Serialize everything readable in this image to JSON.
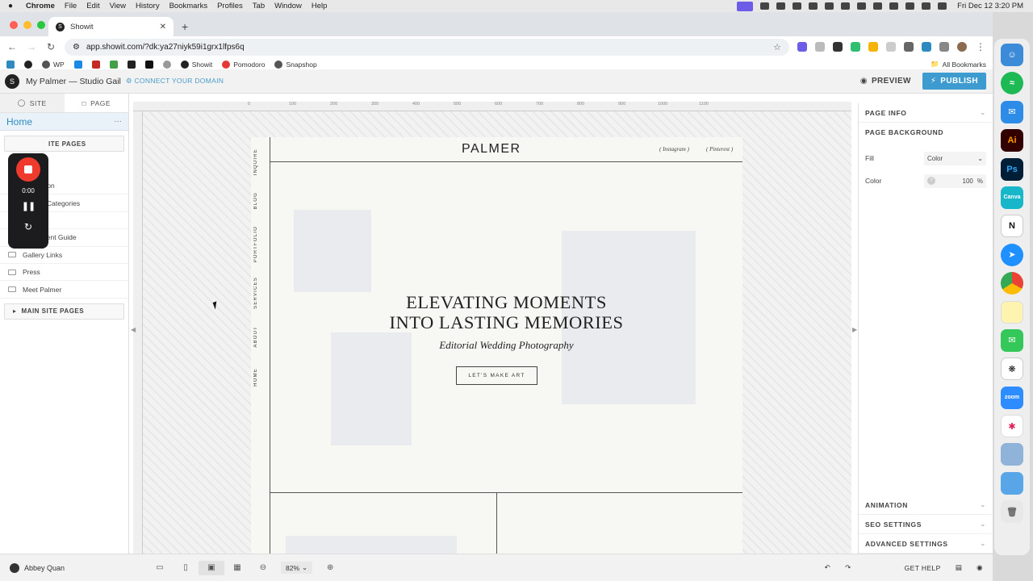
{
  "menubar": {
    "app": "Chrome",
    "items": [
      "File",
      "Edit",
      "View",
      "History",
      "Bookmarks",
      "Profiles",
      "Tab",
      "Window",
      "Help"
    ],
    "clock": "Fri Dec 12  3:20 PM"
  },
  "browser": {
    "tab_title": "Showit",
    "url": "app.showit.com/?dk:ya27niyk59i1grx1lfps6q",
    "bookmarks": [
      "WP",
      "Showit",
      "Pomodoro",
      "Snapshop"
    ],
    "all_bookmarks": "All Bookmarks"
  },
  "app": {
    "site_name": "My Palmer — Studio Gail",
    "connect_domain": "CONNECT YOUR DOMAIN",
    "preview": "PREVIEW",
    "publish": "PUBLISH"
  },
  "left_panel": {
    "tab_site": "SITE",
    "tab_page": "PAGE",
    "current_page": "Home",
    "group_top": "ITE PAGES",
    "partial_rows": [
      "tion",
      "Categories"
    ],
    "pages": [
      "Investment Guide",
      "Gallery Links",
      "Press",
      "Meet Palmer"
    ],
    "group_main": "MAIN SITE PAGES"
  },
  "recorder": {
    "timer": "0:00"
  },
  "canvas": {
    "ruler_ticks": [
      "0",
      "100",
      "200",
      "300",
      "400",
      "500",
      "600",
      "700",
      "800",
      "900",
      "1000",
      "1100"
    ],
    "nav_items": [
      "INQUIRE",
      "BLOG",
      "PORTFOLIO",
      "SERVICES",
      "ABOUT",
      "HOME"
    ],
    "brand": "PALMER",
    "social_instagram": "( Instagram )",
    "social_pinterest": "( Pinterest )",
    "headline_line1": "ELEVATING MOMENTS",
    "headline_line2": "INTO LASTING MEMORIES",
    "subheadline": "Editorial Wedding Photography",
    "cta": "LET'S MAKE ART"
  },
  "right_panel": {
    "page_info": "PAGE INFO",
    "page_background": "PAGE BACKGROUND",
    "fill_label": "Fill",
    "fill_value": "Color",
    "color_label": "Color",
    "opacity_value": "100",
    "opacity_unit": "%",
    "animation": "ANIMATION",
    "seo": "SEO SETTINGS",
    "advanced": "ADVANCED SETTINGS"
  },
  "bottom_bar": {
    "user": "Abbey Quan",
    "zoom": "82%",
    "get_help": "GET HELP"
  },
  "dock_apps": [
    "Finder",
    "Spotify",
    "Mail",
    "Illustrator",
    "Photoshop",
    "Canva",
    "Notion",
    "Safari",
    "Chrome",
    "Notes",
    "Messages",
    "ChatGPT",
    "Zoom",
    "Slack",
    "Preview",
    "Folder",
    "Trash"
  ],
  "colors": {
    "publish": "#3d9bd0",
    "accent_blue": "#2e8ac0",
    "record": "#ef3b2d"
  }
}
